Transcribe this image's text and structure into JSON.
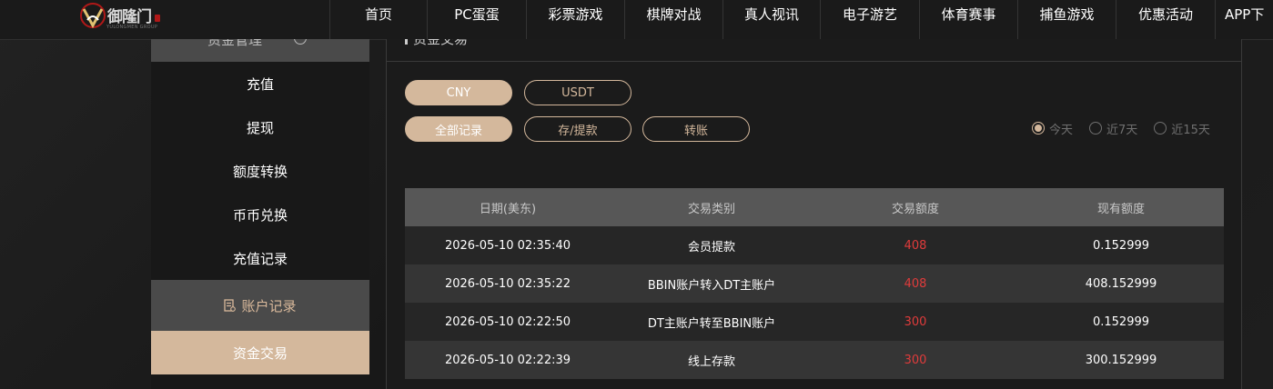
{
  "header": {
    "logo": {
      "title": "御隆门",
      "subtitle": "YULONGMEN GROUP"
    },
    "nav": [
      {
        "label": "首页"
      },
      {
        "label": "PC蛋蛋"
      },
      {
        "label": "彩票游戏"
      },
      {
        "label": "棋牌对战"
      },
      {
        "label": "真人视讯"
      },
      {
        "label": "电子游艺"
      },
      {
        "label": "体育赛事"
      },
      {
        "label": "捕鱼游戏"
      },
      {
        "label": "优惠活动"
      },
      {
        "label": "APP下"
      }
    ]
  },
  "sidebar": {
    "header_title": "资金管理",
    "items": [
      {
        "label": "充值"
      },
      {
        "label": "提现"
      },
      {
        "label": "额度转换"
      },
      {
        "label": "币币兑换"
      },
      {
        "label": "充值记录"
      }
    ],
    "section": {
      "label": "账户记录",
      "icon": "document-icon"
    },
    "active_item": {
      "label": "资金交易"
    }
  },
  "main": {
    "title": "资金交易",
    "currency_tabs": [
      {
        "label": "CNY",
        "selected": true
      },
      {
        "label": "USDT",
        "selected": false
      }
    ],
    "type_tabs": [
      {
        "label": "全部记录",
        "selected": true
      },
      {
        "label": "存/提款",
        "selected": false
      },
      {
        "label": "转账",
        "selected": false
      }
    ],
    "date_filters": [
      {
        "label": "今天",
        "checked": true
      },
      {
        "label": "近7天",
        "checked": false
      },
      {
        "label": "近15天",
        "checked": false
      }
    ],
    "table": {
      "headers": [
        "日期(美东)",
        "交易类别",
        "交易额度",
        "现有额度"
      ],
      "rows": [
        {
          "date": "2026-05-10 02:35:40",
          "type": "会员提款",
          "amount": "408",
          "balance": "0.152999"
        },
        {
          "date": "2026-05-10 02:35:22",
          "type": "BBIN账户转入DT主账户",
          "amount": "408",
          "balance": "408.152999"
        },
        {
          "date": "2026-05-10 02:22:50",
          "type": "DT主账户转至BBIN账户",
          "amount": "300",
          "balance": "0.152999"
        },
        {
          "date": "2026-05-10 02:22:39",
          "type": "线上存款",
          "amount": "300",
          "balance": "300.152999"
        }
      ]
    }
  },
  "colors": {
    "accent": "#d4b89c",
    "amount": "#e03b3b",
    "background": "#1b1b1b"
  }
}
